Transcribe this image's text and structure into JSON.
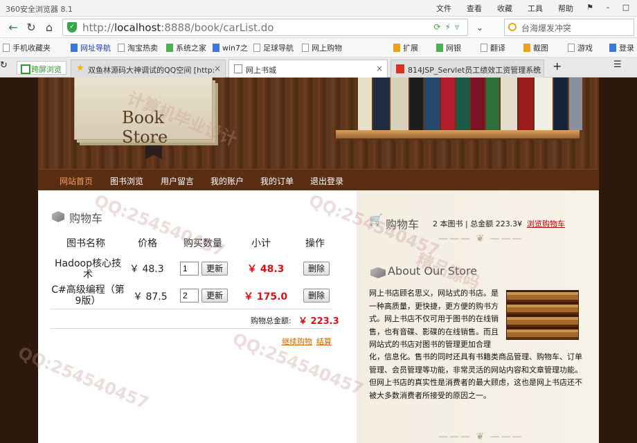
{
  "browser": {
    "app_title": "360安全浏览器 8.1",
    "menu": [
      "文件",
      "查看",
      "收藏",
      "工具",
      "帮助"
    ],
    "address": {
      "prefix": "http://",
      "host": "localhost",
      "rest": ":8888/book/carList.do"
    },
    "search_placeholder": "台海爆发冲突",
    "bookmarks": [
      "手机收藏夹",
      "网址导航",
      "淘宝热卖",
      "系统之家",
      "win7之",
      "足球导航",
      "网上购物",
      "扩展",
      "网银",
      "翻译",
      "截图",
      "游戏",
      "登录"
    ],
    "tabs": [
      {
        "label": "跨屏浏览"
      },
      {
        "label": "双鱼林源码大神调试的QQ空间 [http:"
      },
      {
        "label": "网上书城"
      },
      {
        "label": "814JSP_Servlet员工绩效工资管理系统"
      }
    ]
  },
  "banner": {
    "logo_text": "Book Store"
  },
  "nav": [
    "网站首页",
    "图书浏览",
    "用户留言",
    "我的账户",
    "我的订单",
    "退出登录"
  ],
  "cart": {
    "title": "购物车",
    "headers": [
      "图书名称",
      "价格",
      "购买数量",
      "小计",
      "操作"
    ],
    "rows": [
      {
        "name": "Hadoop核心技术",
        "price": "￥ 48.3",
        "qty": "1",
        "update": "更新",
        "subtotal": "￥ 48.3",
        "delete": "删除"
      },
      {
        "name": "C#高级编程（第9版）",
        "price": "￥ 87.5",
        "qty": "2",
        "update": "更新",
        "subtotal": "￥ 175.0",
        "delete": "删除"
      }
    ],
    "total_label": "购物总金额:",
    "total_value": "￥ 223.3",
    "continue_label": "继续购物",
    "checkout_label": "结算"
  },
  "sidebar": {
    "cart_title": "购物车",
    "cart_summary": "2 本图书 | 总金额 223.3¥",
    "cart_link": "浏览购物车",
    "about_title": "About Our Store",
    "about_text_1": "网上书店顾名思义，网站式的书店。是一种高质量，更快捷，更方便的购书方式。网上书店不仅可用于图书的在线销售，也有音碟、影碟的在线销售。而且网站式的书店对图书的管理更加合理",
    "about_text_2": "化，信息化。售书的同时还具有书籍类商品管理、购物车、订单管理、会员管理等功能，非常灵活的网站内容和文章管理功能。但网上书店的真实性是消费者的最大顾虑，这也是网上书店还不被大多数消费者所接受的原因之一。"
  },
  "watermarks": [
    "QQ:254540457",
    "计算机毕业设计",
    "精品源码"
  ],
  "colors": {
    "nav_bg": "#5b2e14",
    "subtotal": "#dd1111",
    "link": "#cc6600"
  }
}
